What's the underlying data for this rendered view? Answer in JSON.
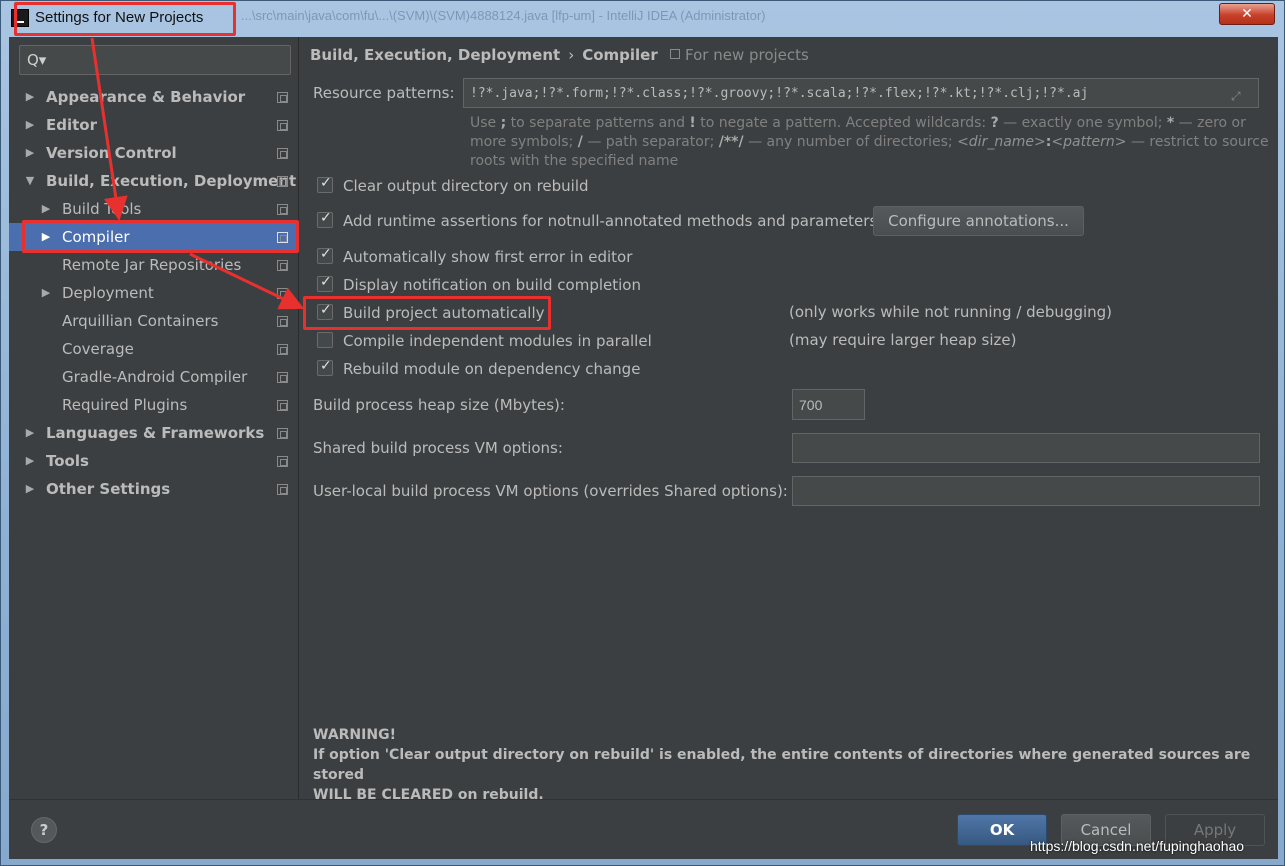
{
  "window": {
    "title": "Settings for New Projects",
    "background_title": "...\\src\\main\\java\\com\\fu\\...\\(SVM)\\(SVM)4888124.java [lfp-um] - IntelliJ IDEA (Administrator)",
    "close_label": "✕"
  },
  "search": {
    "glyph": "Q▾",
    "placeholder": ""
  },
  "sidebar": {
    "items": [
      {
        "label": "Appearance & Behavior",
        "arrow": "▶"
      },
      {
        "label": "Editor",
        "arrow": "▶"
      },
      {
        "label": "Version Control",
        "arrow": "▶"
      },
      {
        "label": "Build, Execution, Deployment",
        "arrow": "▼"
      },
      {
        "label": "Build Tools",
        "arrow": "▶"
      },
      {
        "label": "Compiler",
        "arrow": "▶"
      },
      {
        "label": "Remote Jar Repositories",
        "arrow": ""
      },
      {
        "label": "Deployment",
        "arrow": "▶"
      },
      {
        "label": "Arquillian Containers",
        "arrow": ""
      },
      {
        "label": "Coverage",
        "arrow": ""
      },
      {
        "label": "Gradle-Android Compiler",
        "arrow": ""
      },
      {
        "label": "Required Plugins",
        "arrow": ""
      },
      {
        "label": "Languages & Frameworks",
        "arrow": "▶"
      },
      {
        "label": "Tools",
        "arrow": "▶"
      },
      {
        "label": "Other Settings",
        "arrow": "▶"
      }
    ]
  },
  "breadcrumb": {
    "parent": "Build, Execution, Deployment",
    "separator": "›",
    "current": "Compiler",
    "scope": "For new projects"
  },
  "resource_patterns": {
    "label": "Resource patterns:",
    "value": "!?*.java;!?*.form;!?*.class;!?*.groovy;!?*.scala;!?*.flex;!?*.kt;!?*.clj;!?*.aj",
    "expand_glyph": "⤢",
    "hint_1": "Use",
    "hint_semicolon": ";",
    "hint_2": "to separate patterns and",
    "hint_bang": "!",
    "hint_3": "to negate a pattern. Accepted wildcards:",
    "hint_q": "?",
    "hint_4": "— exactly one symbol;",
    "hint_star": "*",
    "hint_5": "— zero or more symbols;",
    "hint_slash": "/",
    "hint_6": "— path separator;",
    "hint_dstar": "/**/",
    "hint_7": "— any number of directories;",
    "hint_dir": "<dir_name>",
    "hint_colon": ":",
    "hint_pattern": "<pattern>",
    "hint_8": "— restrict to source roots with the specified name"
  },
  "options": {
    "clear_output": {
      "label": "Clear output directory on rebuild",
      "checked": true
    },
    "runtime_assertions": {
      "label": "Add runtime assertions for notnull-annotated methods and parameters",
      "checked": true
    },
    "configure_annotations": "Configure annotations...",
    "show_first_error": {
      "label": "Automatically show first error in editor",
      "checked": true
    },
    "display_notification": {
      "label": "Display notification on build completion",
      "checked": true
    },
    "build_automatically": {
      "label": "Build project automatically",
      "checked": true,
      "note": "(only works while not running / debugging)"
    },
    "compile_parallel": {
      "label": "Compile independent modules in parallel",
      "checked": false,
      "note": "(may require larger heap size)"
    },
    "rebuild_on_dependency": {
      "label": "Rebuild module on dependency change",
      "checked": true
    }
  },
  "heap": {
    "label": "Build process heap size (Mbytes):",
    "value": "700"
  },
  "shared_vm": {
    "label": "Shared build process VM options:",
    "value": ""
  },
  "user_vm": {
    "label": "User-local build process VM options (overrides Shared options):",
    "value": ""
  },
  "warning": {
    "title": "WARNING!",
    "line1": "If option 'Clear output directory on rebuild' is enabled, the entire contents of directories where generated sources are stored",
    "line2": "WILL BE CLEARED on rebuild."
  },
  "footer": {
    "help": "?",
    "ok": "OK",
    "cancel": "Cancel",
    "apply": "Apply"
  },
  "watermark": "https://blog.csdn.net/fupinghaohao",
  "colors": {
    "annotation": "#e8312f",
    "selection": "#4b6eaf",
    "panel": "#3c3f41"
  }
}
